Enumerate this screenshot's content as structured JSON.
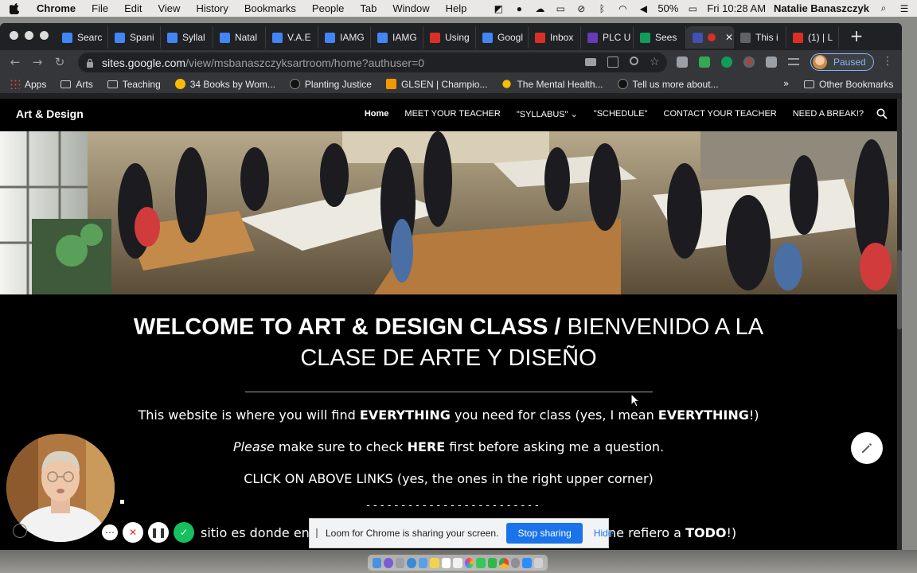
{
  "menubar": {
    "app": "Chrome",
    "items": [
      "File",
      "Edit",
      "View",
      "History",
      "Bookmarks",
      "People",
      "Tab",
      "Window",
      "Help"
    ],
    "battery": "50%",
    "clock": "Fri 10:28 AM",
    "user": "Natalie Banaszczyk"
  },
  "tabs": [
    {
      "label": "Searc",
      "color": "#4285f4"
    },
    {
      "label": "Spani",
      "color": "#4285f4"
    },
    {
      "label": "Syllal",
      "color": "#4285f4"
    },
    {
      "label": "Natal",
      "color": "#4285f4"
    },
    {
      "label": "V.A.E",
      "color": "#4285f4"
    },
    {
      "label": "IAMG",
      "color": "#4285f4"
    },
    {
      "label": "IAMG",
      "color": "#4285f4"
    },
    {
      "label": "Using",
      "color": "#d93025"
    },
    {
      "label": "Googl",
      "color": "#4285f4"
    },
    {
      "label": "Inbox",
      "color": "#d93025"
    },
    {
      "label": "PLC U",
      "color": "#673ab7"
    },
    {
      "label": "Sees",
      "color": "#0f9d58"
    },
    {
      "label": "",
      "color": "#3f51b5"
    },
    {
      "label": "This i",
      "color": "#5f6368"
    },
    {
      "label": "(1) | L",
      "color": "#d93025"
    }
  ],
  "toolbar": {
    "url_host": "sites.google.com",
    "url_path": "/view/msbanaszczyksartroom/home?authuser=0",
    "profile_label": "Paused"
  },
  "bookmarks": {
    "items": [
      "Apps",
      "Arts",
      "Teaching",
      "34 Books by Wom...",
      "Planting Justice",
      "GLSEN | Champio...",
      "The Mental Health...",
      "Tell us more about..."
    ],
    "more": "»",
    "other": "Other Bookmarks"
  },
  "site": {
    "title": "Art & Design",
    "nav": [
      "Home",
      "MEET YOUR TEACHER",
      "\"SYLLABUS\"",
      "\"SCHEDULE\"",
      "CONTACT YOUR TEACHER",
      "NEED A BREAK!?"
    ]
  },
  "content": {
    "headline_bold": "WELCOME TO ART & DESIGN CLASS /",
    "headline_regular": " BIENVENIDO A LA CLASE DE ARTE Y DISEÑO",
    "p1_a": "This website is where you will find ",
    "p1_b": "EVERYTHING",
    "p1_c": " you need for class (yes, I mean ",
    "p1_d": "EVERYTHING",
    "p1_e": "!)",
    "p2_a": "Please",
    "p2_b": " make sure to check ",
    "p2_c": "HERE",
    "p2_d": " first before asking me a question.",
    "p3": "CLICK ON ABOVE LINKS (yes, the ones in the right upper corner)",
    "dashes": "-------------------------",
    "spanish_visible": "sitio es donde en",
    "spanish_tail_a": "ne refiero a ",
    "spanish_tail_b": "TODO",
    "spanish_tail_c": "!)"
  },
  "share_bar": {
    "message": "Loom for Chrome is sharing your screen.",
    "stop": "Stop sharing",
    "hide": "Hide"
  }
}
